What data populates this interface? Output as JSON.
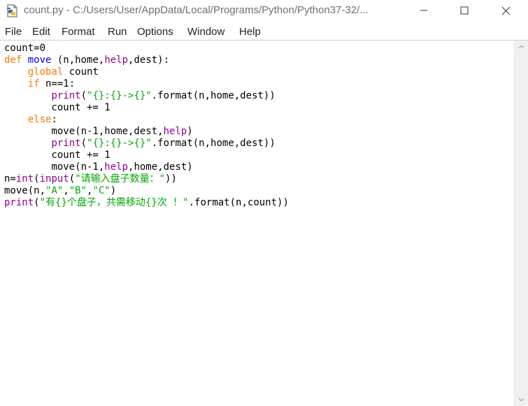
{
  "window": {
    "title": "count.py - C:/Users/User/AppData/Local/Programs/Python/Python37-32/..."
  },
  "menubar": {
    "items": [
      "File",
      "Edit",
      "Format",
      "Run",
      "Options",
      "Window",
      "Help"
    ]
  },
  "colors": {
    "keyword": "#ff7700",
    "builtin": "#900090",
    "string": "#00aa00",
    "definition": "#0000ff",
    "text": "#000000"
  },
  "editor": {
    "lines": [
      [
        {
          "t": "count=0",
          "c": "pl"
        }
      ],
      [
        {
          "t": "def",
          "c": "kw"
        },
        {
          "t": " ",
          "c": "pl"
        },
        {
          "t": "move",
          "c": "df"
        },
        {
          "t": " (n,home,",
          "c": "pl"
        },
        {
          "t": "help",
          "c": "bi"
        },
        {
          "t": ",dest):",
          "c": "pl"
        }
      ],
      [
        {
          "t": "    ",
          "c": "pl"
        },
        {
          "t": "global",
          "c": "kw"
        },
        {
          "t": " count",
          "c": "pl"
        }
      ],
      [
        {
          "t": "    ",
          "c": "pl"
        },
        {
          "t": "if",
          "c": "kw"
        },
        {
          "t": " n==1:",
          "c": "pl"
        }
      ],
      [
        {
          "t": "        ",
          "c": "pl"
        },
        {
          "t": "print",
          "c": "bi"
        },
        {
          "t": "(",
          "c": "pl"
        },
        {
          "t": "\"{}:{}->{}\"",
          "c": "st"
        },
        {
          "t": ".format(n,home,dest))",
          "c": "pl"
        }
      ],
      [
        {
          "t": "        count += 1",
          "c": "pl"
        }
      ],
      [
        {
          "t": "    ",
          "c": "pl"
        },
        {
          "t": "else",
          "c": "kw"
        },
        {
          "t": ":",
          "c": "pl"
        }
      ],
      [
        {
          "t": "        move(n-1,home,dest,",
          "c": "pl"
        },
        {
          "t": "help",
          "c": "bi"
        },
        {
          "t": ")",
          "c": "pl"
        }
      ],
      [
        {
          "t": "        ",
          "c": "pl"
        },
        {
          "t": "print",
          "c": "bi"
        },
        {
          "t": "(",
          "c": "pl"
        },
        {
          "t": "\"{}:{}->{}\"",
          "c": "st"
        },
        {
          "t": ".format(n,home,dest))",
          "c": "pl"
        }
      ],
      [
        {
          "t": "        count += 1",
          "c": "pl"
        }
      ],
      [
        {
          "t": "        move(n-1,",
          "c": "pl"
        },
        {
          "t": "help",
          "c": "bi"
        },
        {
          "t": ",home,dest)",
          "c": "pl"
        }
      ],
      [
        {
          "t": "n=",
          "c": "pl"
        },
        {
          "t": "int",
          "c": "bi"
        },
        {
          "t": "(",
          "c": "pl"
        },
        {
          "t": "input",
          "c": "bi"
        },
        {
          "t": "(",
          "c": "pl"
        },
        {
          "t": "\"请输入盘子数量：\"",
          "c": "st"
        },
        {
          "t": "))",
          "c": "pl"
        }
      ],
      [
        {
          "t": "move(n,",
          "c": "pl"
        },
        {
          "t": "\"A\"",
          "c": "st"
        },
        {
          "t": ",",
          "c": "pl"
        },
        {
          "t": "\"B\"",
          "c": "st"
        },
        {
          "t": ",",
          "c": "pl"
        },
        {
          "t": "\"C\"",
          "c": "st"
        },
        {
          "t": ")",
          "c": "pl"
        }
      ],
      [
        {
          "t": "print",
          "c": "bi"
        },
        {
          "t": "(",
          "c": "pl"
        },
        {
          "t": "\"有{}个盘子，共需移动{}次 ！\"",
          "c": "st"
        },
        {
          "t": ".format(n,count))",
          "c": "pl"
        }
      ]
    ]
  }
}
